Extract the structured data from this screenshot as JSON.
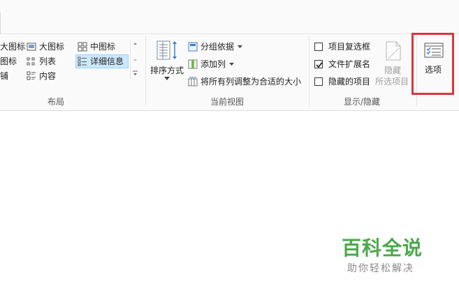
{
  "layout_group": {
    "label": "布局",
    "items": {
      "large_icons_cut": "大图标",
      "large_icons": "大图标",
      "medium_icons": "中图标",
      "small_icons_cut": "图标",
      "list": "列表",
      "details": "详细信息",
      "tiles_cut": "铺",
      "content": "内容"
    }
  },
  "current_view_group": {
    "label": "当前视图",
    "sort_by": "排序方式",
    "group_by": "分组依据",
    "add_columns": "添加列",
    "size_all_columns": "将所有列调整为合适的大小"
  },
  "show_hide_group": {
    "label": "显示/隐藏",
    "item_checkboxes": {
      "label": "项目复选框",
      "checked": false
    },
    "file_extensions": {
      "label": "文件扩展名",
      "checked": true
    },
    "hidden_items": {
      "label": "隐藏的项目",
      "checked": false
    },
    "hide_line1": "隐藏",
    "hide_line2": "所选项目"
  },
  "options": {
    "label": "选项"
  },
  "watermark": {
    "title": "百科全说",
    "subtitle": "助你轻松解决"
  },
  "colors": {
    "highlight_red": "#d9363e",
    "selection_blue": "#cce8ff",
    "watermark_green": "#4aa84a"
  }
}
